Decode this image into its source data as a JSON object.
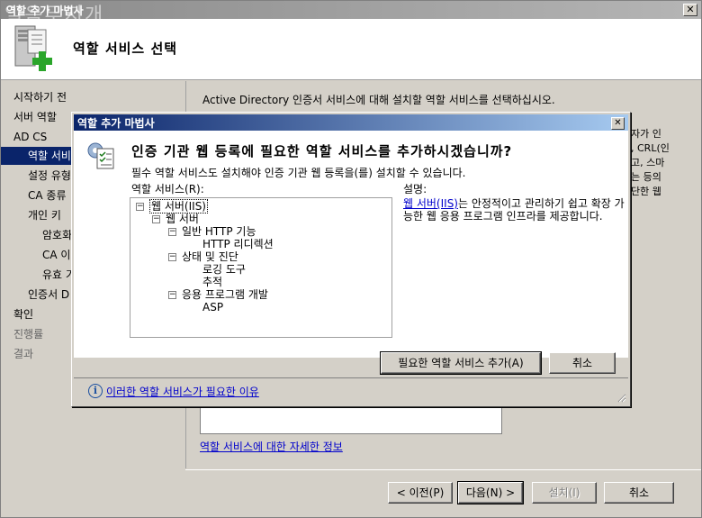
{
  "outer_window": {
    "title": "역할 추가 마법사",
    "ghost_overlay": "일음무지개",
    "close_label": "✕"
  },
  "header": {
    "title": "역할 서비스 선택",
    "icon": "server-add-icon"
  },
  "left_nav": {
    "items": [
      {
        "label": "시작하기 전",
        "state": "normal",
        "level": 0
      },
      {
        "label": "서버 역할",
        "state": "normal",
        "level": 0
      },
      {
        "label": "AD CS",
        "state": "normal",
        "level": 0
      },
      {
        "label": "역할 서비",
        "state": "active",
        "level": 1
      },
      {
        "label": "설정 유형",
        "state": "normal",
        "level": 1
      },
      {
        "label": "CA 종류",
        "state": "normal",
        "level": 1
      },
      {
        "label": "개인 키",
        "state": "normal",
        "level": 1
      },
      {
        "label": "암호화",
        "state": "normal",
        "level": 2
      },
      {
        "label": "CA 이",
        "state": "normal",
        "level": 2
      },
      {
        "label": "유효 기",
        "state": "normal",
        "level": 2
      },
      {
        "label": "인증서 D",
        "state": "normal",
        "level": 1
      },
      {
        "label": "확인",
        "state": "normal",
        "level": 0
      },
      {
        "label": "진행률",
        "state": "disabled",
        "level": 0
      },
      {
        "label": "결과",
        "state": "disabled",
        "level": 0
      }
    ]
  },
  "content": {
    "description": "Active Directory 인증서 서비스에 대해 설치할 역할 서비스를 선택하십시오.",
    "right_fragment": [
      "자가 인",
      ", CRL(인",
      "고, 스마",
      "는 등의",
      "단한 웹"
    ],
    "more_info_link": "역할 서비스에 대한 자세한 정보"
  },
  "footer": {
    "prev_label": "< 이전(P)",
    "next_label": "다음(N) >",
    "install_label": "설치(I)",
    "cancel_label": "취소"
  },
  "modal": {
    "title": "역할 추가 마법사",
    "close_label": "✕",
    "heading": "인증 기관 웹 등록에 필요한 역할 서비스를 추가하시겠습니까?",
    "subtext": "필수 역할 서비스도 설치해야 인증 기관 웹 등록을(를) 설치할 수 있습니다.",
    "roles_label": "역할 서비스(R):",
    "tree": [
      {
        "label": "웹 서버(IIS)",
        "expander": "⊟",
        "indent": 0,
        "selected": true
      },
      {
        "label": "웹 서버",
        "expander": "⊟",
        "indent": 1
      },
      {
        "label": "일반 HTTP 기능",
        "expander": "⊟",
        "indent": 2
      },
      {
        "label": "HTTP 리디렉션",
        "expander": "",
        "indent": 3
      },
      {
        "label": "상태 및 진단",
        "expander": "⊟",
        "indent": 2
      },
      {
        "label": "로깅 도구",
        "expander": "",
        "indent": 3
      },
      {
        "label": "추적",
        "expander": "",
        "indent": 3
      },
      {
        "label": "응용 프로그램 개발",
        "expander": "⊟",
        "indent": 2
      },
      {
        "label": "ASP",
        "expander": "",
        "indent": 3
      }
    ],
    "desc_label": "설명:",
    "desc_link": "웹 서버(IIS)",
    "desc_text": "는 안정적이고 관리하기 쉽고 확장 가능한 웹 응용 프로그램 인프라를 제공합니다.",
    "add_button": "필요한 역할 서비스 추가(A)",
    "cancel_button": "취소",
    "why_link": "이러한 역할 서비스가 필요한 이유"
  }
}
